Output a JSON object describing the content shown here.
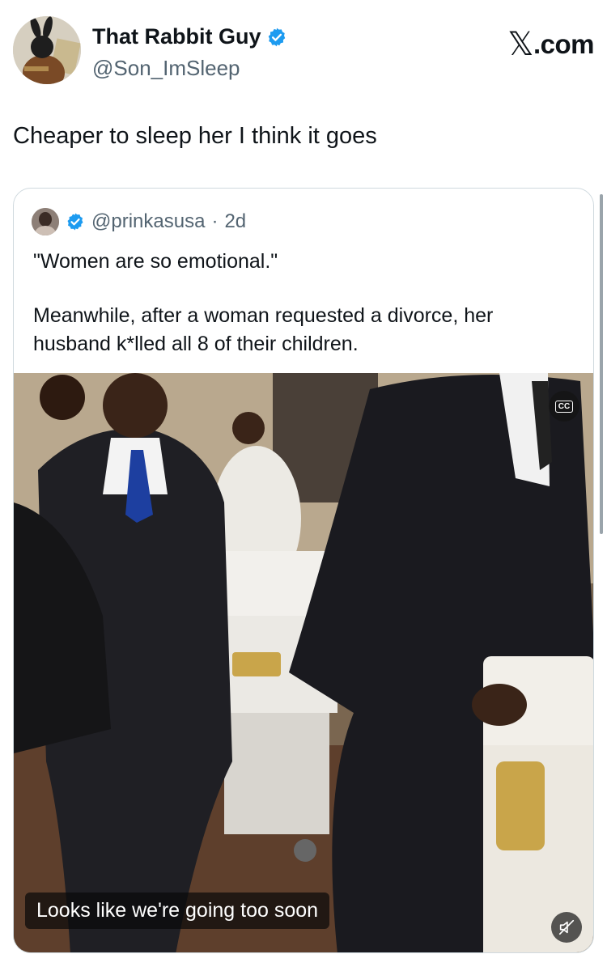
{
  "post": {
    "display_name": "That Rabbit Guy",
    "handle": "@Son_ImSleep",
    "verified": true,
    "text": "Cheaper to sleep her I think it goes"
  },
  "brand": {
    "x_glyph": "𝕏",
    "suffix": ".com"
  },
  "quote": {
    "handle": "@prinkasusa",
    "separator": "·",
    "time": "2d",
    "verified": true,
    "line1": "\"Women are so emotional.\"",
    "line2": "Meanwhile, after a woman requested a divorce, her husband k*lled all 8 of their children."
  },
  "video": {
    "cc_label": "CC",
    "caption": "Looks like we're going too soon",
    "icons": [
      "closed-captions-icon",
      "mute-icon"
    ]
  },
  "colors": {
    "verified_blue": "#1d9bf0",
    "text": "#0f1419",
    "secondary": "#536471",
    "border": "#cfd9de"
  }
}
